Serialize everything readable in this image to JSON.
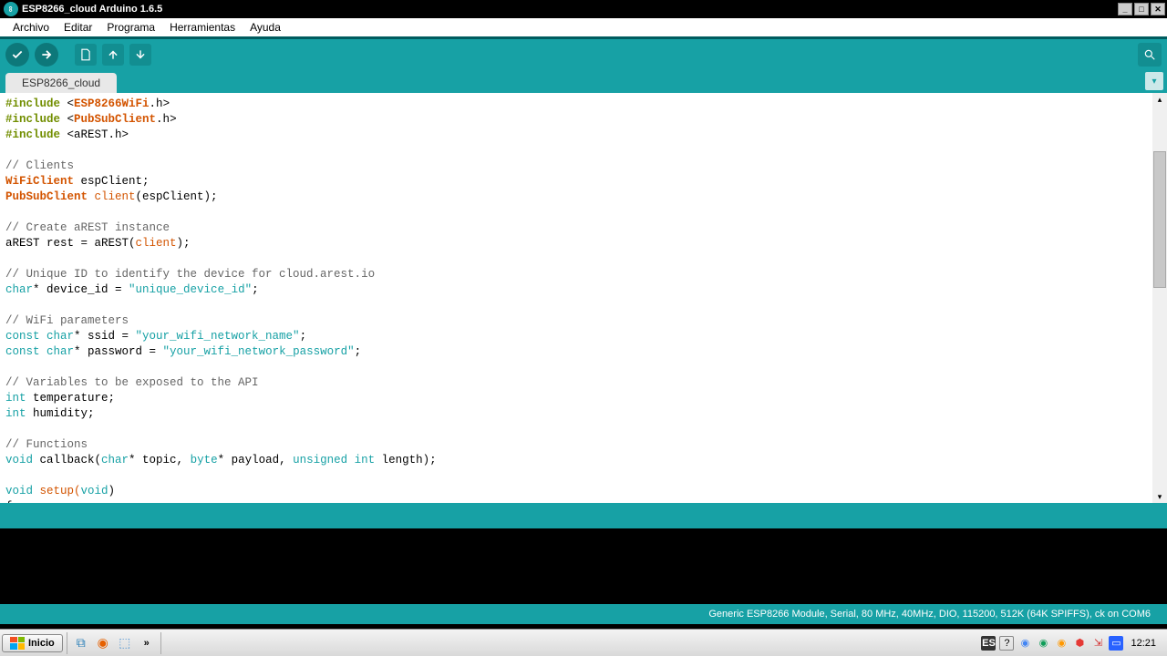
{
  "window": {
    "title": "ESP8266_cloud Arduino 1.6.5"
  },
  "menu": {
    "archivo": "Archivo",
    "editar": "Editar",
    "programa": "Programa",
    "herramientas": "Herramientas",
    "ayuda": "Ayuda"
  },
  "tab": {
    "name": "ESP8266_cloud"
  },
  "code": {
    "l1_inc": "#include ",
    "l1_lib": "ESP8266WiFi",
    "l1_ext": ".h",
    "l2_lib": "PubSubClient",
    "l3_lib": "aREST.h",
    "cmt_clients": "// Clients",
    "wificlient": "WiFiClient",
    "espclient_decl": " espClient;",
    "pubsub": "PubSubClient",
    "client_id": "client",
    "client_call": "(espClient);",
    "cmt_create": "// Create aREST instance",
    "arest_line_a": "aREST rest = aREST(",
    "arest_line_b": ");",
    "cmt_uid": "// Unique ID to identify the device for cloud.arest.io",
    "char": "char",
    "device_var": "* device_id = ",
    "device_str": "\"unique_device_id\"",
    "semi": ";",
    "cmt_wifi": "// WiFi parameters",
    "const_char": "const char",
    "ssid_var": "* ssid = ",
    "ssid_str": "\"your_wifi_network_name\"",
    "pass_var": "* password = ",
    "pass_str": "\"your_wifi_network_password\"",
    "cmt_vars": "// Variables to be exposed to the API",
    "int": "int",
    "temp_var": " temperature;",
    "hum_var": " humidity;",
    "cmt_func": "// Functions",
    "void": "void",
    "callback_sig_a": " callback(",
    "callback_sig_b": "* topic, ",
    "byte": "byte",
    "callback_sig_c": "* payload, ",
    "unsigned_int": "unsigned int",
    "callback_sig_d": " length);",
    "setup_a": " setup(",
    "setup_b": ")",
    "brace": "{"
  },
  "status": {
    "text": "Generic ESP8266 Module, Serial, 80 MHz, 40MHz, DIO, 115200, 512K (64K SPIFFS), ck on COM6"
  },
  "taskbar": {
    "start": "Inicio",
    "ql_more": "»",
    "lang": "ES",
    "clock": "12:21"
  }
}
